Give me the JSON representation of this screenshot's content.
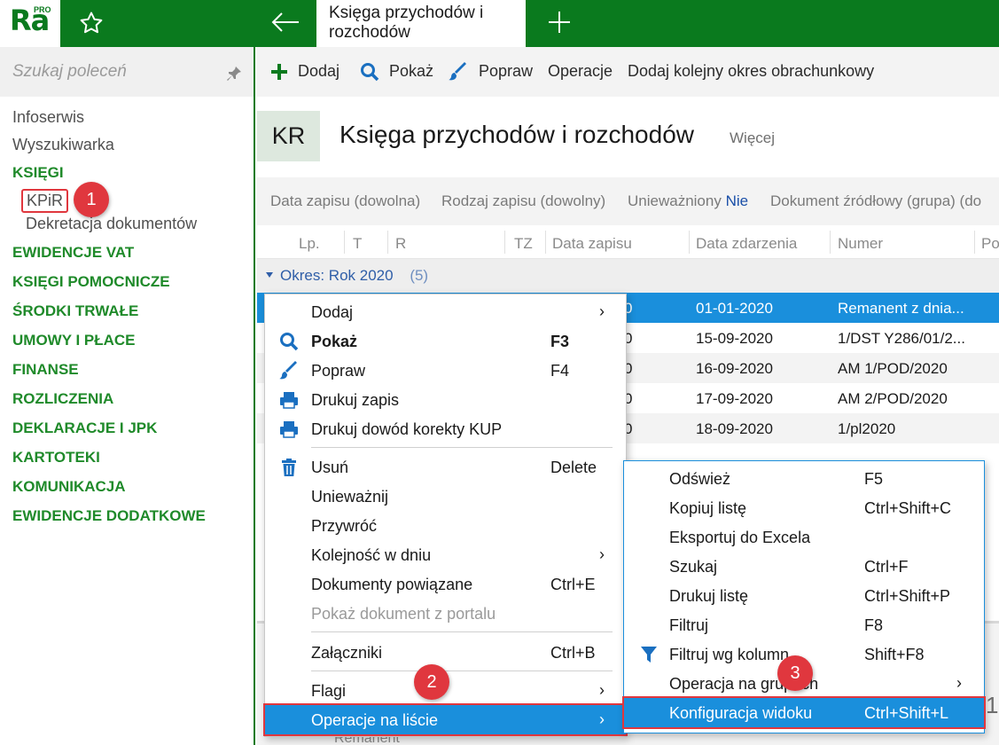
{
  "app": {
    "logo": "Ra",
    "logo_sup": "PRO",
    "active_tab": "Księga przychodów i rozchodów"
  },
  "sidebar": {
    "search_placeholder": "Szukaj poleceń",
    "items": [
      "Infoserwis",
      "Wyszukiwarka"
    ],
    "sections": [
      "KSIĘGI",
      "EWIDENCJE VAT",
      "KSIĘGI POMOCNICZE",
      "ŚRODKI TRWAŁE",
      "UMOWY I PŁACE",
      "FINANSE",
      "ROZLICZENIA",
      "DEKLARACJE I JPK",
      "KARTOTEKI",
      "KOMUNIKACJA",
      "EWIDENCJE DODATKOWE"
    ],
    "subitems": [
      "KPiR",
      "Dekretacja dokumentów"
    ]
  },
  "toolbar": {
    "add": "Dodaj",
    "show": "Pokaż",
    "edit": "Popraw",
    "operations": "Operacje",
    "add_period": "Dodaj kolejny okres obrachunkowy"
  },
  "header": {
    "badge": "KR",
    "title": "Księga przychodów i rozchodów",
    "more": "Więcej"
  },
  "filters": {
    "date": "Data zapisu (dowolna)",
    "type": "Rodzaj zapisu (dowolny)",
    "void_label": "Unieważniony",
    "void_value": "Nie",
    "source": "Dokument źródłowy (grupa) (do"
  },
  "grid": {
    "columns": [
      "Lp.",
      "T",
      "R",
      "TZ",
      "Data zapisu",
      "Data zdarzenia",
      "Numer",
      "Po"
    ],
    "group_label": "Okres:",
    "group_value": "Rok 2020",
    "group_count": "(5)",
    "rows": [
      {
        "date_frag": "0",
        "event_date": "01-01-2020",
        "number": "Remanent z dnia..."
      },
      {
        "date_frag": "0",
        "event_date": "15-09-2020",
        "number": "1/DST Y286/01/2..."
      },
      {
        "date_frag": "0",
        "event_date": "16-09-2020",
        "number": "AM 1/POD/2020"
      },
      {
        "date_frag": "0",
        "event_date": "17-09-2020",
        "number": "AM 2/POD/2020"
      },
      {
        "date_frag": "0",
        "event_date": "18-09-2020",
        "number": "1/pl2020"
      }
    ],
    "footer_tail": "Remanent",
    "edge_digit": "1"
  },
  "context_menu": {
    "items": [
      {
        "label": "Dodaj",
        "shortcut": "",
        "arrow": "›"
      },
      {
        "label": "Pokaż",
        "shortcut": "F3"
      },
      {
        "label": "Popraw",
        "shortcut": "F4"
      },
      {
        "label": "Drukuj zapis",
        "shortcut": ""
      },
      {
        "label": "Drukuj dowód korekty KUP",
        "shortcut": ""
      },
      {
        "label": "Usuń",
        "shortcut": "Delete"
      },
      {
        "label": "Unieważnij",
        "shortcut": ""
      },
      {
        "label": "Przywróć",
        "shortcut": ""
      },
      {
        "label": "Kolejność w dniu",
        "shortcut": "",
        "arrow": "›"
      },
      {
        "label": "Dokumenty powiązane",
        "shortcut": "Ctrl+E"
      },
      {
        "label": "Pokaż dokument z portalu",
        "shortcut": ""
      },
      {
        "label": "Załączniki",
        "shortcut": "Ctrl+B"
      },
      {
        "label": "Flagi",
        "shortcut": "",
        "arrow": "›"
      },
      {
        "label": "Operacje na liście",
        "shortcut": "",
        "arrow": "›"
      }
    ]
  },
  "submenu": {
    "items": [
      {
        "label": "Odśwież",
        "shortcut": "F5"
      },
      {
        "label": "Kopiuj listę",
        "shortcut": "Ctrl+Shift+C"
      },
      {
        "label": "Eksportuj do Excela",
        "shortcut": ""
      },
      {
        "label": "Szukaj",
        "shortcut": "Ctrl+F"
      },
      {
        "label": "Drukuj listę",
        "shortcut": "Ctrl+Shift+P"
      },
      {
        "label": "Filtruj",
        "shortcut": "F8"
      },
      {
        "label": "Filtruj wg kolumn",
        "shortcut": "Shift+F8"
      },
      {
        "label": "Operacja na grupach",
        "shortcut": "",
        "arrow": "›"
      },
      {
        "label": "Konfiguracja widoku",
        "shortcut": "Ctrl+Shift+L"
      }
    ]
  },
  "badges": [
    "1",
    "2",
    "3"
  ],
  "colors": {
    "brand_green": "#0a7a1e",
    "section_green": "#1f8a2a",
    "selection_blue": "#1a8fdc",
    "highlight_red": "#e0373e"
  }
}
